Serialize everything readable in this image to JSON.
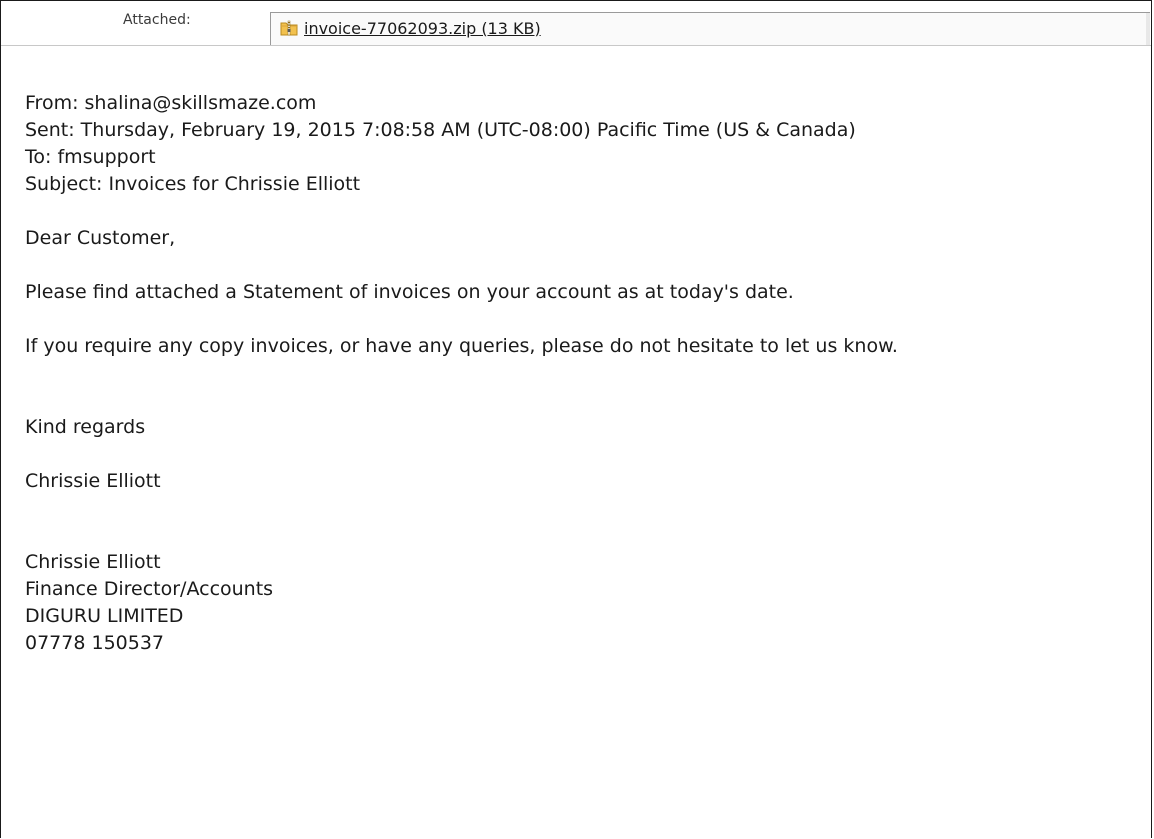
{
  "attachment_bar": {
    "label": "Attached:",
    "file_name": "invoice-77062093.zip (13 KB)",
    "file_icon": "zip-archive-icon"
  },
  "header": {
    "from": "From: shalina@skillsmaze.com",
    "sent": "Sent: Thursday, February 19, 2015 7:08:58 AM (UTC-08:00) Pacific Time (US & Canada)",
    "to": "To: fmsupport",
    "subject": "Subject: Invoices for Chrissie Elliott"
  },
  "message": {
    "greeting": "Dear Customer,",
    "paragraph1": "Please find attached a Statement of invoices on your account as at today's date.",
    "paragraph2": "If you require any copy invoices, or have any queries, please do not hesitate to let us know.",
    "closing": "Kind regards",
    "signoff_name": "Chrissie Elliott"
  },
  "signature": {
    "name": "Chrissie Elliott",
    "title": "Finance Director/Accounts",
    "company": "DIGURU LIMITED",
    "phone": "07778 150537"
  }
}
